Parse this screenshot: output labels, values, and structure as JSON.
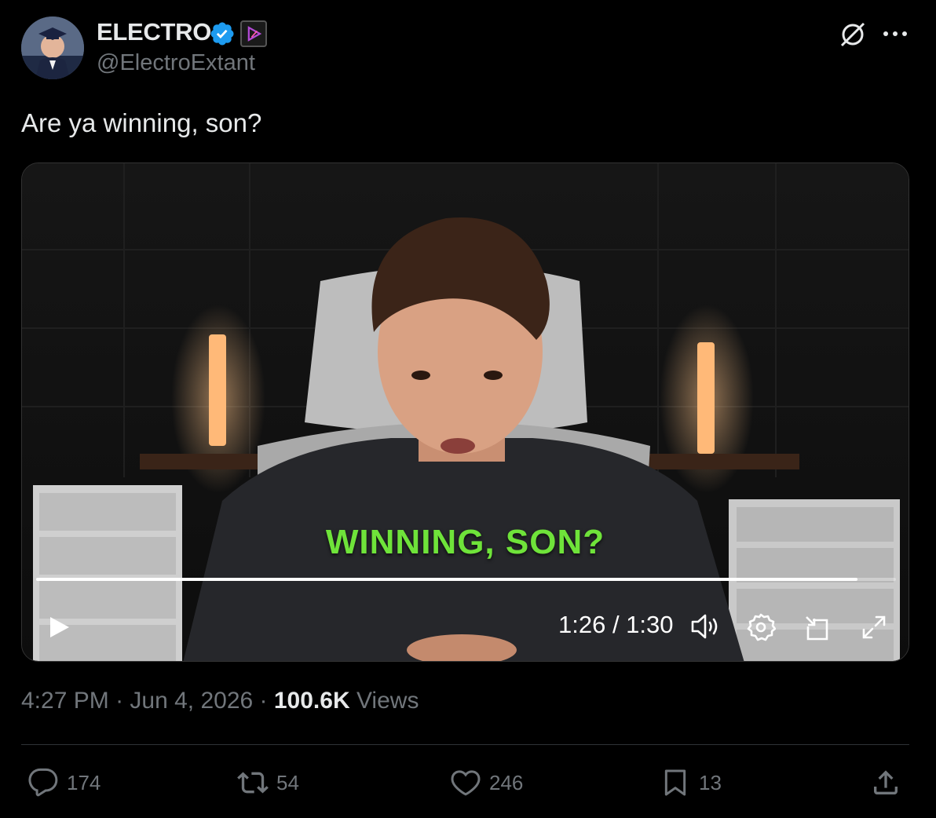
{
  "author": {
    "display_name": "ELECTRO",
    "handle": "@ElectroExtant",
    "verified": true
  },
  "tweet": {
    "text": "Are ya winning, son?"
  },
  "video": {
    "caption": "WINNING, SON?",
    "time": "1:26 / 1:30",
    "progress": 0.955
  },
  "meta": {
    "time": "4:27 PM",
    "separator1": " · ",
    "date": "Jun 4, 2026",
    "separator2": " · ",
    "views_count": "100.6K",
    "views_label": " Views"
  },
  "actions": {
    "replies": "174",
    "reposts": "54",
    "likes": "246",
    "bookmarks": "13"
  },
  "colors": {
    "accent_blue": "#1d9bf0",
    "caption_green": "#6fe33a",
    "muted_text": "#71767b"
  }
}
